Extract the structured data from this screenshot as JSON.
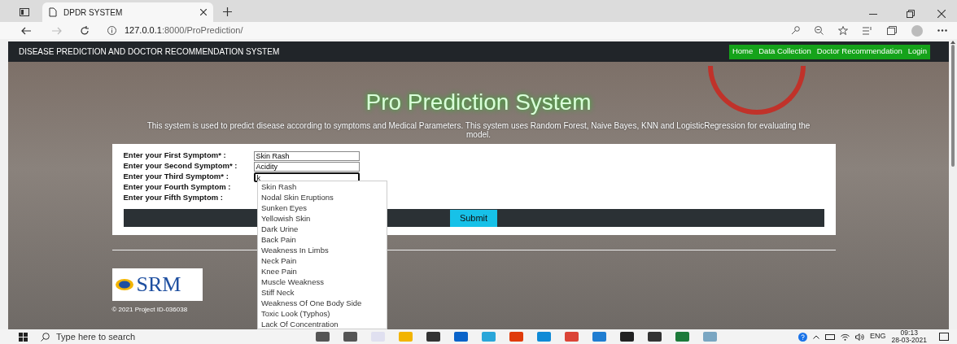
{
  "browser": {
    "tab_title": "DPDR SYSTEM",
    "url_host": "127.0.0.1",
    "url_path": ":8000/ProPrediction/"
  },
  "navbar": {
    "brand": "DISEASE PREDICTION AND DOCTOR RECOMMENDATION SYSTEM",
    "links": [
      {
        "label": "Home"
      },
      {
        "label": "Data Collection"
      },
      {
        "label": "Doctor Recommendation"
      },
      {
        "label": "Login"
      }
    ]
  },
  "hero": {
    "title": "Pro Prediction System",
    "description": "This system is used to predict disease according to symptoms and Medical Parameters. This system uses Random Forest, Naive Bayes, KNN and LogisticRegression for evaluating the model."
  },
  "form": {
    "fields": [
      {
        "label": "Enter your First Symptom* :",
        "value": "Skin Rash",
        "focused": false
      },
      {
        "label": "Enter your Second Symptom* :",
        "value": "Acidity",
        "focused": false
      },
      {
        "label": "Enter your Third Symptom* :",
        "value": "k",
        "focused": true
      },
      {
        "label": "Enter your Fourth Symptom :",
        "focused": false
      },
      {
        "label": "Enter your Fifth Symptom :",
        "focused": false
      }
    ],
    "submit": "Submit"
  },
  "autocomplete": [
    "Skin Rash",
    "Nodal Skin Eruptions",
    "Sunken Eyes",
    "Yellowish Skin",
    "Dark Urine",
    "Back Pain",
    "Weakness In Limbs",
    "Neck Pain",
    "Knee Pain",
    "Muscle Weakness",
    "Stiff Neck",
    "Weakness Of One Body Side",
    "Toxic Look (Typhos)",
    "Lack Of Concentration"
  ],
  "footer": {
    "logo": "SRM",
    "copyright": "© 2021 Project ID-036038"
  },
  "taskbar": {
    "search_placeholder": "Type here to search",
    "language": "ENG",
    "time": "09:13",
    "date": "28-03-2021"
  }
}
